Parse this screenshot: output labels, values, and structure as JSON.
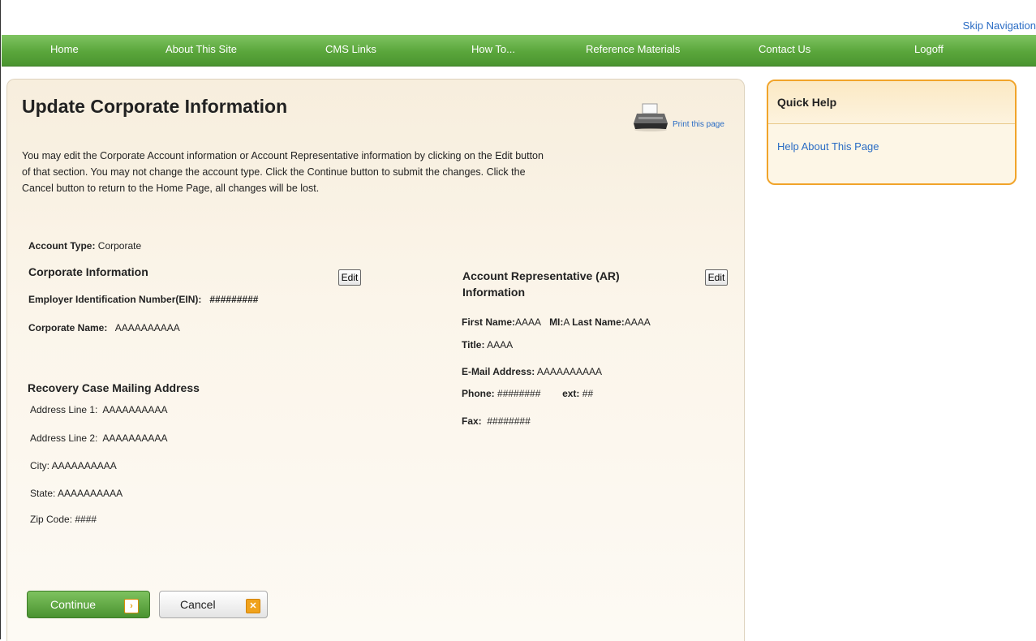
{
  "skip_navigation": "Skip Navigation",
  "nav": {
    "items": [
      {
        "label": "Home"
      },
      {
        "label": "About This Site"
      },
      {
        "label": "CMS Links"
      },
      {
        "label": "How To..."
      },
      {
        "label": "Reference Materials"
      },
      {
        "label": "Contact Us"
      },
      {
        "label": "Logoff"
      }
    ]
  },
  "main": {
    "title": "Update Corporate Information",
    "print_label": "Print this page",
    "intro_lines": [
      "You may edit the Corporate Account information or Account Representative information by clicking on the Edit button",
      "of that section. You may not change the account type. Click the Continue button to submit the changes. Click the",
      "Cancel button to return to the Home Page, all changes will be lost."
    ],
    "account_type": {
      "label": "Account Type:",
      "value": "Corporate"
    },
    "corporate": {
      "title": "Corporate Information",
      "edit_label": "Edit",
      "ein_label": "Employer Identification Number(EIN):",
      "ein_value": "#########",
      "name_label": "Corporate Name:",
      "name_value": "AAAAAAAAAA"
    },
    "mailing": {
      "title": "Recovery Case Mailing Address",
      "line1_label": "Address Line 1:",
      "line1_value": "AAAAAAAAAA",
      "line2_label": "Address Line 2:",
      "line2_value": "AAAAAAAAAA",
      "city_label": "City:",
      "city_value": "AAAAAAAAAA",
      "state_label": "State:",
      "state_value": "AAAAAAAAAA",
      "zip_label": "Zip Code:",
      "zip_value": "####"
    },
    "ar": {
      "title_line1": "Account Representative (AR)",
      "title_line2": "Information",
      "edit_label": "Edit",
      "first_name_label": "First Name:",
      "first_name_value": "AAAA",
      "mi_label": "MI:",
      "mi_value": "A",
      "last_name_label": "Last Name:",
      "last_name_value": "AAAA",
      "title_label": "Title:",
      "title_value": "AAAA",
      "email_label": "E-Mail Address:",
      "email_value": "AAAAAAAAAA",
      "phone_label": "Phone:",
      "phone_value": "########",
      "ext_label": "ext:",
      "ext_value": "##",
      "fax_label": "Fax:",
      "fax_value": "########"
    },
    "buttons": {
      "continue_label": "Continue",
      "cancel_label": "Cancel"
    }
  },
  "quick_help": {
    "title": "Quick Help",
    "link": "Help About This Page"
  },
  "colors": {
    "nav_green": "#5aa63b",
    "link_blue": "#2a6cc4",
    "help_border": "#f1a42a",
    "panel_bg": "#f7eedd"
  }
}
